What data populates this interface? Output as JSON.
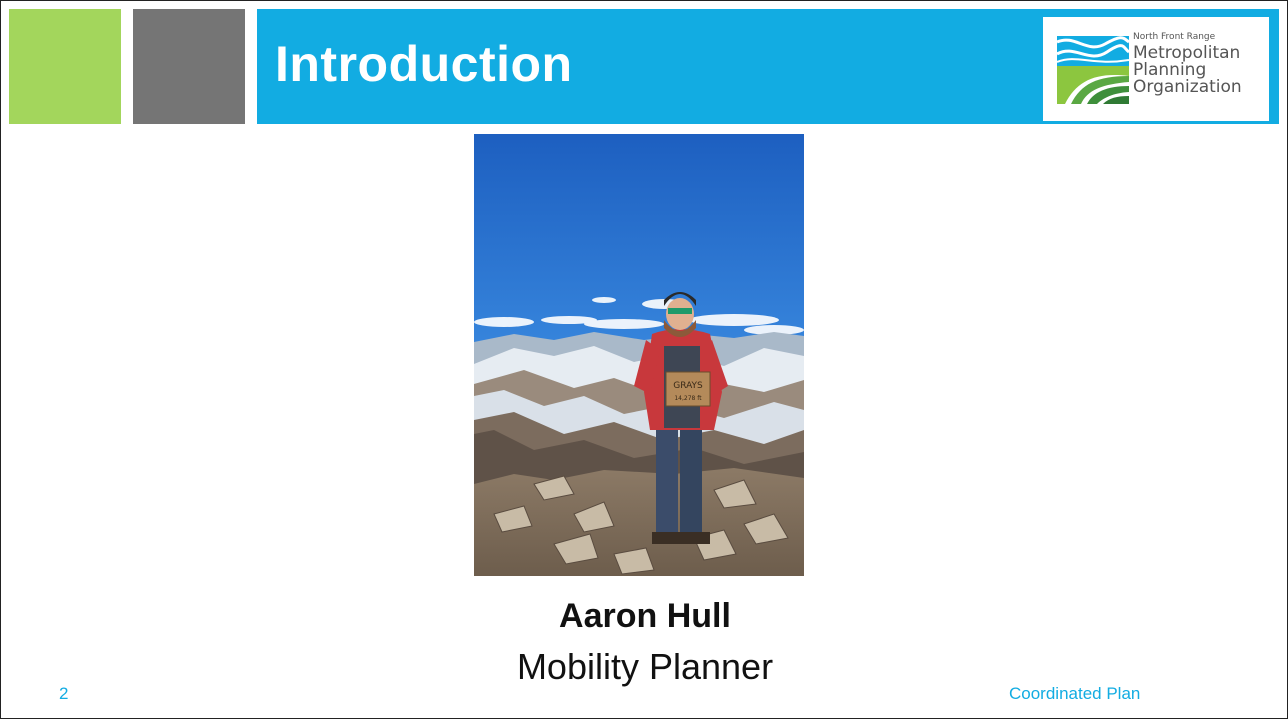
{
  "slide": {
    "title": "Introduction",
    "name": "Aaron Hull",
    "role": "Mobility Planner",
    "slide_number": "2",
    "footer": "Coordinated Plan"
  },
  "logo": {
    "line1": "North Front Range",
    "line2": "Metropolitan",
    "line3": "Planning",
    "line4": "Organization",
    "icon": "nfrmpo-wave-logo"
  },
  "photo": {
    "sign_line1": "GRAYS",
    "sign_line2": "14,278 ft"
  },
  "colors": {
    "accent_blue": "#12ace2",
    "accent_green": "#a3d65c",
    "accent_gray": "#757575"
  }
}
